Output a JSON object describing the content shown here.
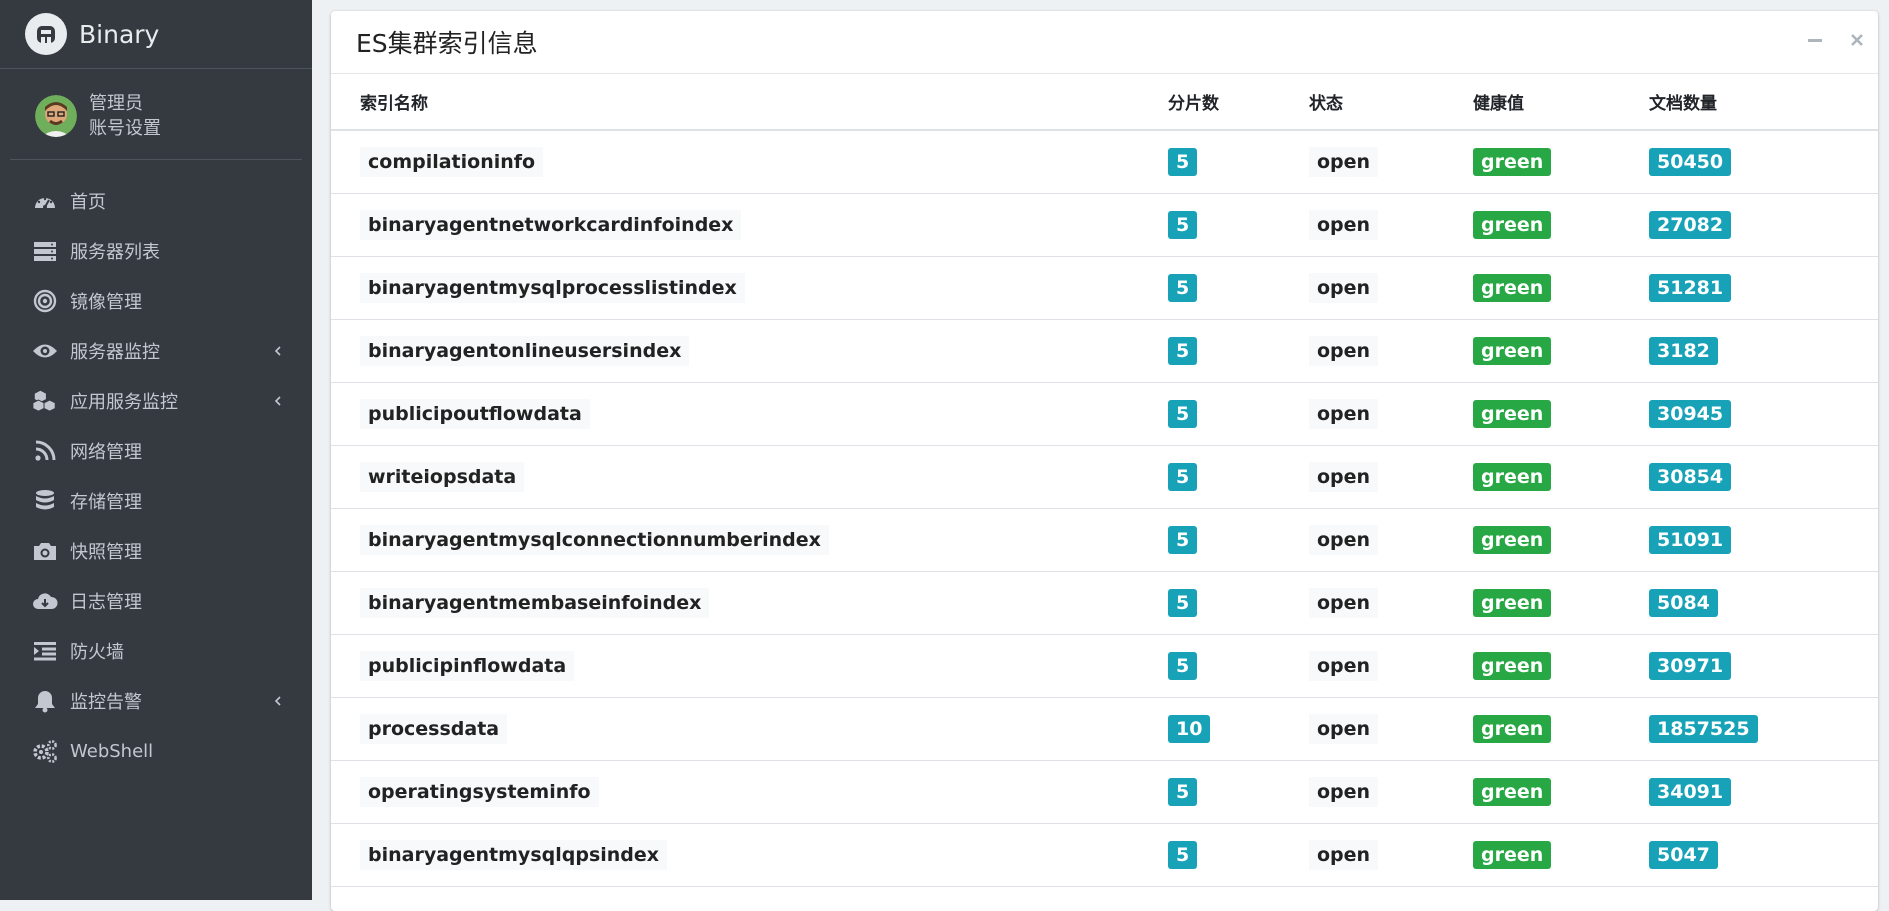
{
  "brand": {
    "name": "Binary"
  },
  "user": {
    "name": "管理员",
    "settings_link": "账号设置"
  },
  "nav": [
    {
      "label": "首页",
      "icon": "dashboard-icon",
      "has_submenu": false
    },
    {
      "label": "服务器列表",
      "icon": "server-icon",
      "has_submenu": false
    },
    {
      "label": "镜像管理",
      "icon": "target-icon",
      "has_submenu": false
    },
    {
      "label": "服务器监控",
      "icon": "eye-icon",
      "has_submenu": true
    },
    {
      "label": "应用服务监控",
      "icon": "cubes-icon",
      "has_submenu": true
    },
    {
      "label": "网络管理",
      "icon": "rss-icon",
      "has_submenu": false
    },
    {
      "label": "存储管理",
      "icon": "database-icon",
      "has_submenu": false
    },
    {
      "label": "快照管理",
      "icon": "camera-icon",
      "has_submenu": false
    },
    {
      "label": "日志管理",
      "icon": "cloud-download-icon",
      "has_submenu": false
    },
    {
      "label": "防火墙",
      "icon": "indent-icon",
      "has_submenu": false
    },
    {
      "label": "监控告警",
      "icon": "bell-icon",
      "has_submenu": true
    },
    {
      "label": "WebShell",
      "icon": "cogs-icon",
      "has_submenu": false
    }
  ],
  "card": {
    "title": "ES集群索引信息",
    "columns": [
      "索引名称",
      "分片数",
      "状态",
      "健康值",
      "文档数量"
    ],
    "rows": [
      {
        "name": "compilationinfo",
        "shards": "5",
        "status": "open",
        "health": "green",
        "docs": "50450"
      },
      {
        "name": "binaryagentnetworkcardinfoindex",
        "shards": "5",
        "status": "open",
        "health": "green",
        "docs": "27082"
      },
      {
        "name": "binaryagentmysqlprocesslistindex",
        "shards": "5",
        "status": "open",
        "health": "green",
        "docs": "51281"
      },
      {
        "name": "binaryagentonlineusersindex",
        "shards": "5",
        "status": "open",
        "health": "green",
        "docs": "3182"
      },
      {
        "name": "publicipoutflowdata",
        "shards": "5",
        "status": "open",
        "health": "green",
        "docs": "30945"
      },
      {
        "name": "writeiopsdata",
        "shards": "5",
        "status": "open",
        "health": "green",
        "docs": "30854"
      },
      {
        "name": "binaryagentmysqlconnectionnumberindex",
        "shards": "5",
        "status": "open",
        "health": "green",
        "docs": "51091"
      },
      {
        "name": "binaryagentmembaseinfoindex",
        "shards": "5",
        "status": "open",
        "health": "green",
        "docs": "5084"
      },
      {
        "name": "publicipinflowdata",
        "shards": "5",
        "status": "open",
        "health": "green",
        "docs": "30971"
      },
      {
        "name": "processdata",
        "shards": "10",
        "status": "open",
        "health": "green",
        "docs": "1857525"
      },
      {
        "name": "operatingsysteminfo",
        "shards": "5",
        "status": "open",
        "health": "green",
        "docs": "34091"
      },
      {
        "name": "binaryagentmysqlqpsindex",
        "shards": "5",
        "status": "open",
        "health": "green",
        "docs": "5047"
      }
    ]
  },
  "colors": {
    "sidebar": "#343a40",
    "info": "#17a2b8",
    "success": "#28a745"
  }
}
